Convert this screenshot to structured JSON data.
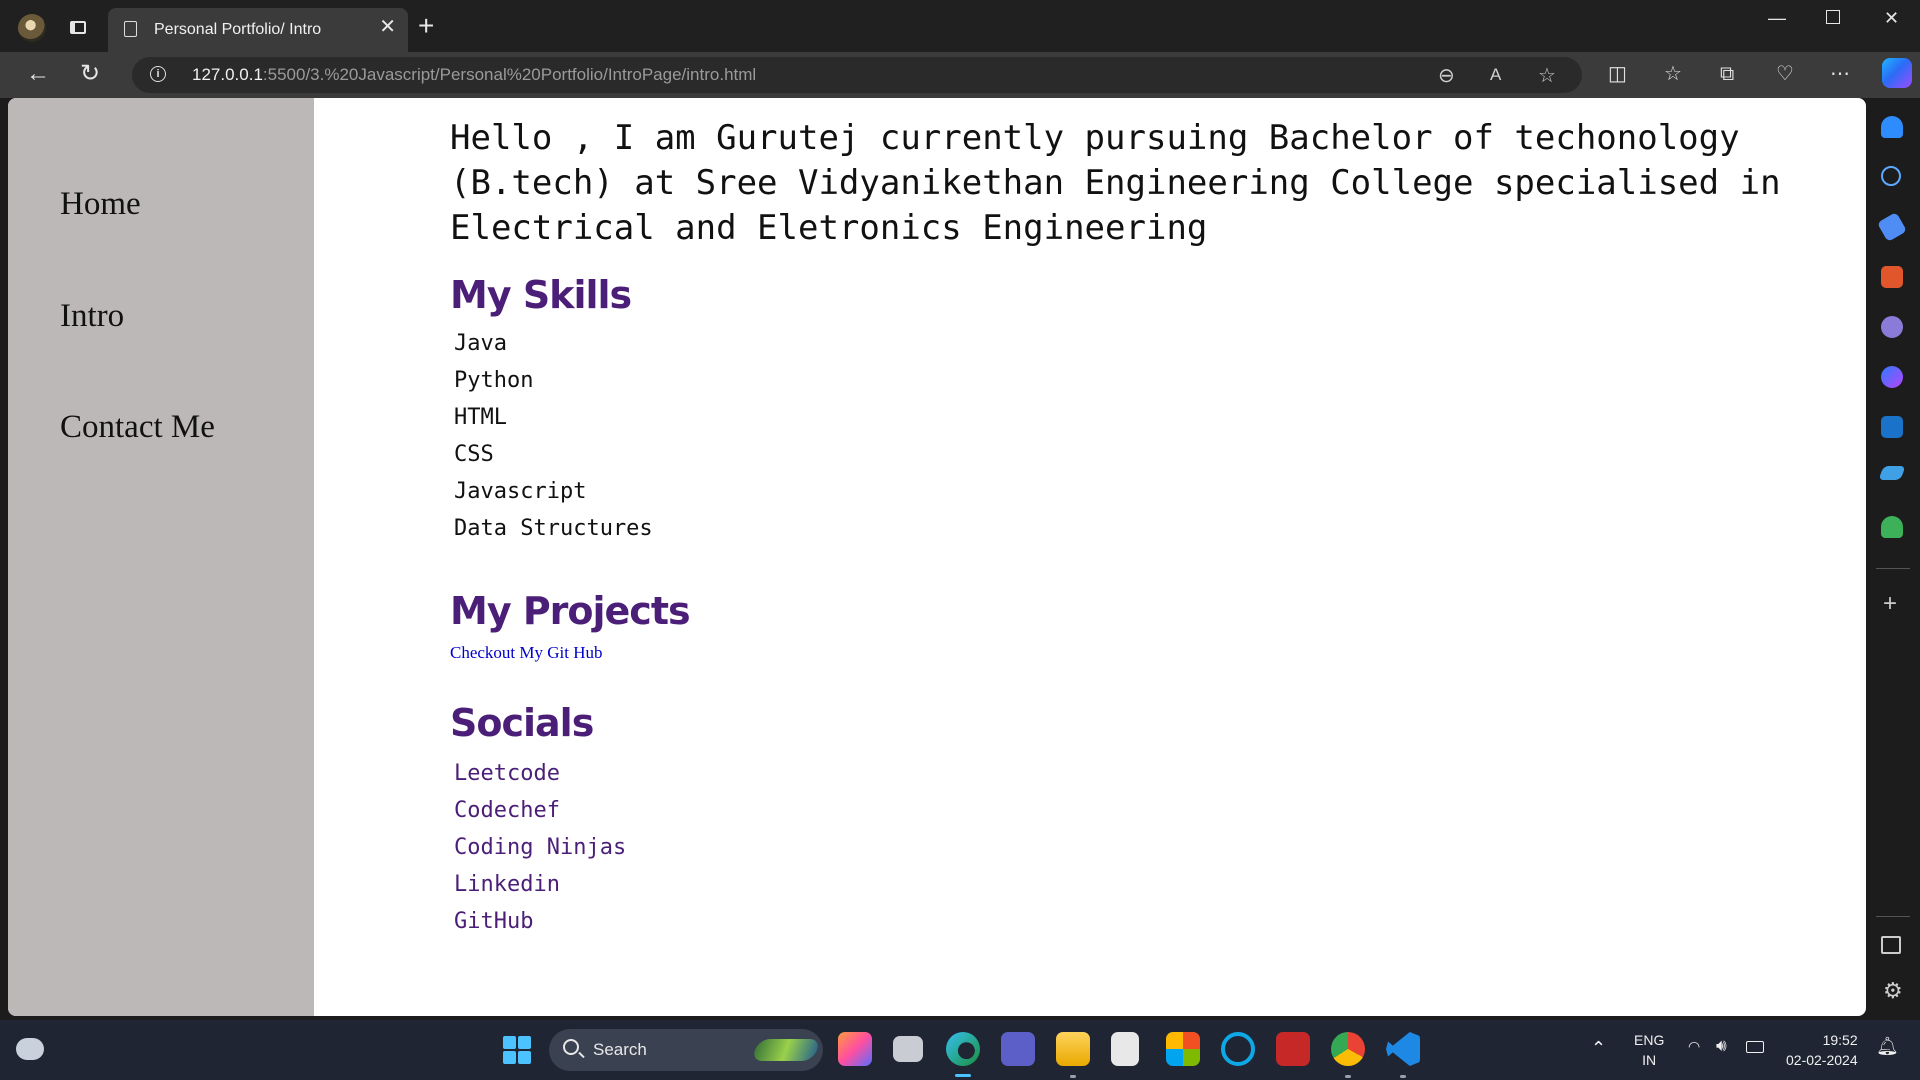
{
  "browser": {
    "tab_title": "Personal Portfolio/ Intro",
    "url_host": "127.0.0.1",
    "url_rest": ":5500/3.%20Javascript/Personal%20Portfolio/IntroPage/intro.html"
  },
  "nav": {
    "items": [
      "Home",
      "Intro",
      "Contact Me"
    ]
  },
  "main": {
    "intro": "Hello , I am Gurutej currently pursuing Bachelor of techonology (B.tech) at Sree Vidyanikethan Engineering College specialised in Electrical and Eletronics Engineering",
    "skills_heading": "My Skills",
    "skills": [
      "Java",
      "Python",
      "HTML",
      "CSS",
      "Javascript",
      "Data Structures"
    ],
    "projects_heading": "My Projects",
    "projects_link": "Checkout My Git Hub",
    "socials_heading": "Socials",
    "socials": [
      "Leetcode",
      "Codechef",
      "Coding Ninjas",
      "Linkedin",
      "GitHub"
    ]
  },
  "taskbar": {
    "search_placeholder": "Search",
    "lang_top": "ENG",
    "lang_bottom": "IN",
    "time": "19:52",
    "date": "02-02-2024"
  }
}
